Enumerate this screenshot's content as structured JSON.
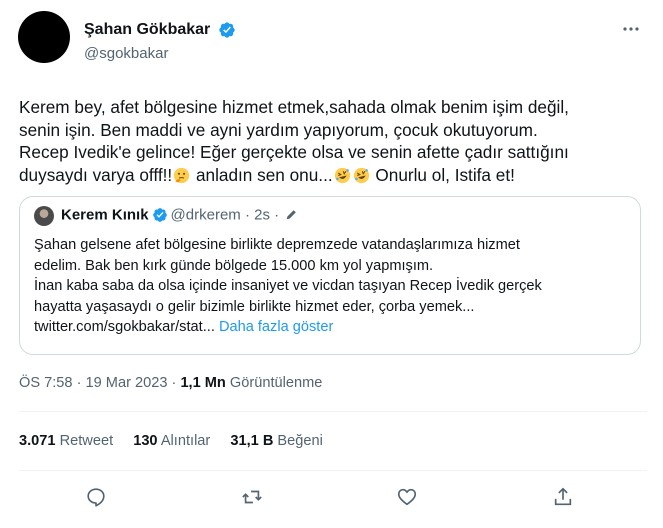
{
  "author": {
    "name": "Şahan Gökbakar",
    "handle": "@sgokbakar",
    "verified_color": "#1d9bf0"
  },
  "tweet": {
    "lines": [
      "Kerem bey, afet bölgesine hizmet etmek,sahada olmak benim işim değil,",
      "senin işin. Ben maddi ve ayni yardım yapıyorum, çocuk okutuyorum.",
      "Recep Ivedik'e gelince! Eğer gerçekte olsa ve senin afette çadır sattığını"
    ],
    "line4_part1": "duysaydı varya offf!!",
    "line4_part2": " anladın sen onu...",
    "line4_part3": " Onurlu ol, Istifa et!",
    "emojis": [
      "thinking-face",
      "rolling-on-floor-laughing",
      "rolling-on-floor-laughing"
    ]
  },
  "quote": {
    "name": "Kerem Kınık",
    "handle": "@drkerem",
    "time": "· 2s ·",
    "lines": [
      "Şahan gelsene afet bölgesine birlikte depremzede vatandaşlarımıza hizmet",
      "edelim. Bak ben kırk günde bölgede 15.000 km yol yapmışım.",
      "İnan kaba saba da olsa içinde insaniyet ve vicdan taşıyan Recep İvedik gerçek",
      "hayatta yaşasaydı o gelir bizimle birlikte hizmet eder, çorba yemek..."
    ],
    "link": "twitter.com/sgokbakar/stat...",
    "show_more": "Daha fazla göster"
  },
  "meta": {
    "time": "ÖS 7:58 · 19 Mar 2023 · ",
    "views_count": "1,1 Mn",
    "views_label": " Görüntülenme"
  },
  "stats": {
    "retweets_count": "3.071",
    "retweets_label": "Retweet",
    "quotes_count": "130",
    "quotes_label": "Alıntılar",
    "likes_count": "31,1 B",
    "likes_label": "Beğeni"
  },
  "actions": [
    "reply-icon",
    "retweet-icon",
    "like-icon",
    "share-icon"
  ]
}
